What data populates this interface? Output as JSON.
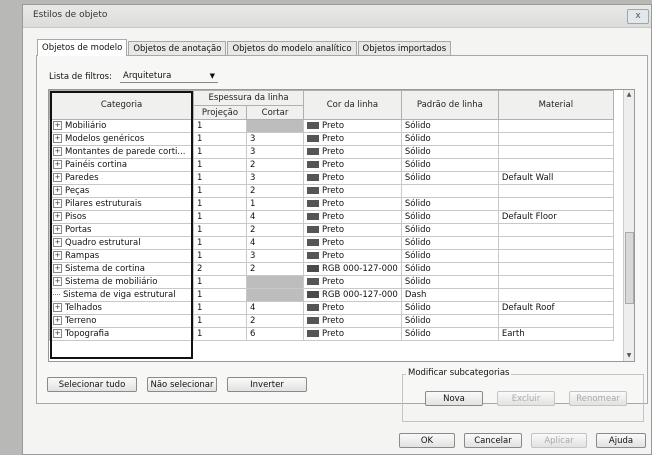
{
  "window": {
    "title": "Estilos de objeto",
    "close_label": "x"
  },
  "tabs": [
    "Objetos de modelo",
    "Objetos de anotação",
    "Objetos do modelo analítico",
    "Objetos importados"
  ],
  "filter": {
    "label": "Lista de filtros:",
    "value": "Arquitetura"
  },
  "table": {
    "headers": {
      "categoria": "Categoria",
      "espessura": "Espessura da linha",
      "projecao": "Projeção",
      "cortar": "Cortar",
      "cor": "Cor da linha",
      "padrao": "Padrão de linha",
      "material": "Material"
    },
    "rows": [
      {
        "name": "Mobiliário",
        "expand": "+",
        "proj": "1",
        "cut": "",
        "cut_gray": true,
        "color": "Preto",
        "swatch": "#555555",
        "pattern": "Sólido",
        "material": ""
      },
      {
        "name": "Modelos genéricos",
        "expand": "+",
        "proj": "1",
        "cut": "3",
        "cut_gray": false,
        "color": "Preto",
        "swatch": "#555555",
        "pattern": "Sólido",
        "material": ""
      },
      {
        "name": "Montantes de parede corti...",
        "expand": "+",
        "proj": "1",
        "cut": "3",
        "cut_gray": false,
        "color": "Preto",
        "swatch": "#555555",
        "pattern": "Sólido",
        "material": ""
      },
      {
        "name": "Painéis cortina",
        "expand": "+",
        "proj": "1",
        "cut": "2",
        "cut_gray": false,
        "color": "Preto",
        "swatch": "#555555",
        "pattern": "Sólido",
        "material": ""
      },
      {
        "name": "Paredes",
        "expand": "+",
        "proj": "1",
        "cut": "3",
        "cut_gray": false,
        "color": "Preto",
        "swatch": "#555555",
        "pattern": "Sólido",
        "material": "Default Wall"
      },
      {
        "name": "Peças",
        "expand": "+",
        "proj": "1",
        "cut": "2",
        "cut_gray": false,
        "color": "Preto",
        "swatch": "#555555",
        "pattern": "",
        "material": ""
      },
      {
        "name": "Pilares estruturais",
        "expand": "+",
        "proj": "1",
        "cut": "1",
        "cut_gray": false,
        "color": "Preto",
        "swatch": "#555555",
        "pattern": "Sólido",
        "material": ""
      },
      {
        "name": "Pisos",
        "expand": "+",
        "proj": "1",
        "cut": "4",
        "cut_gray": false,
        "color": "Preto",
        "swatch": "#555555",
        "pattern": "Sólido",
        "material": "Default Floor"
      },
      {
        "name": "Portas",
        "expand": "+",
        "proj": "1",
        "cut": "2",
        "cut_gray": false,
        "color": "Preto",
        "swatch": "#555555",
        "pattern": "Sólido",
        "material": ""
      },
      {
        "name": "Quadro estrutural",
        "expand": "+",
        "proj": "1",
        "cut": "4",
        "cut_gray": false,
        "color": "Preto",
        "swatch": "#555555",
        "pattern": "Sólido",
        "material": ""
      },
      {
        "name": "Rampas",
        "expand": "+",
        "proj": "1",
        "cut": "3",
        "cut_gray": false,
        "color": "Preto",
        "swatch": "#555555",
        "pattern": "Sólido",
        "material": ""
      },
      {
        "name": "Sistema de cortina",
        "expand": "+",
        "proj": "2",
        "cut": "2",
        "cut_gray": false,
        "color": "RGB 000-127-000",
        "swatch": "#4a4a4a",
        "pattern": "Sólido",
        "material": ""
      },
      {
        "name": "Sistema de mobiliário",
        "expand": "+",
        "proj": "1",
        "cut": "",
        "cut_gray": true,
        "color": "Preto",
        "swatch": "#555555",
        "pattern": "Sólido",
        "material": ""
      },
      {
        "name": "Sistema de viga estrutural",
        "expand": "",
        "proj": "1",
        "cut": "",
        "cut_gray": true,
        "color": "RGB 000-127-000",
        "swatch": "#4a4a4a",
        "pattern": "Dash",
        "material": ""
      },
      {
        "name": "Telhados",
        "expand": "+",
        "proj": "1",
        "cut": "4",
        "cut_gray": false,
        "color": "Preto",
        "swatch": "#555555",
        "pattern": "Sólido",
        "material": "Default Roof"
      },
      {
        "name": "Terreno",
        "expand": "+",
        "proj": "1",
        "cut": "2",
        "cut_gray": false,
        "color": "Preto",
        "swatch": "#555555",
        "pattern": "Sólido",
        "material": ""
      },
      {
        "name": "Topografia",
        "expand": "+",
        "proj": "1",
        "cut": "6",
        "cut_gray": false,
        "color": "Preto",
        "swatch": "#555555",
        "pattern": "Sólido",
        "material": "Earth"
      }
    ]
  },
  "buttons": {
    "select_all": "Selecionar tudo",
    "select_none": "Não selecionar",
    "invert": "Inverter",
    "subcat_legend": "Modificar subcategorias",
    "new": "Nova",
    "delete": "Excluir",
    "rename": "Renomear",
    "ok": "OK",
    "cancel": "Cancelar",
    "apply": "Aplicar",
    "help": "Ajuda"
  }
}
